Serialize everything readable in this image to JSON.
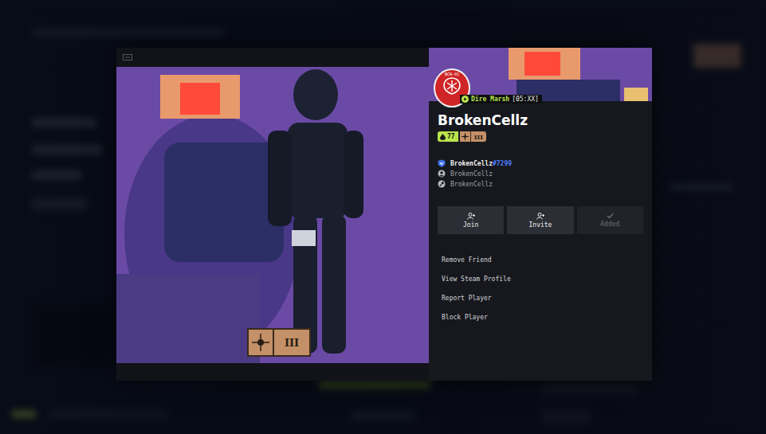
{
  "player": {
    "name": "BrokenCellz",
    "avatar_text": "BCN-01",
    "status": {
      "location": "Dire Marsh",
      "time": "[05:XX]"
    },
    "level": "77",
    "rank_badge": "III"
  },
  "accounts": [
    {
      "name": "BrokenCellz",
      "tag": "#7299",
      "kind": "game"
    },
    {
      "name": "BrokenCellz",
      "tag": "",
      "kind": "user"
    },
    {
      "name": "BrokenCellz",
      "tag": "",
      "kind": "steam"
    }
  ],
  "actions": [
    {
      "label": "Join",
      "disabled": false
    },
    {
      "label": "Invite",
      "disabled": false
    },
    {
      "label": "Added",
      "disabled": true
    }
  ],
  "menu": [
    "Remove Friend",
    "View Steam Profile",
    "Report Player",
    "Block Player"
  ],
  "card_emblem": "III"
}
